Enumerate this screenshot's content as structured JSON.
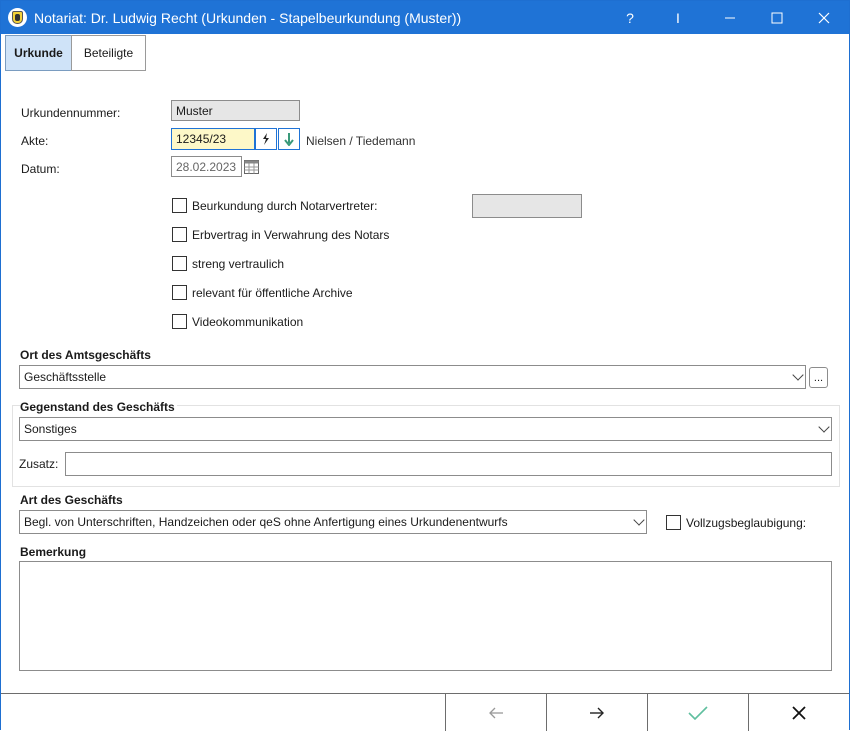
{
  "window": {
    "title": "Notariat: Dr. Ludwig Recht (Urkunden - Stapelbeurkundung (Muster))",
    "help_glyph": "?",
    "cursor_glyph": "I",
    "minimize_glyph": "—",
    "maximize_glyph": "☐",
    "close_glyph": "✕",
    "accent_color": "#1f73d6"
  },
  "tabs": [
    {
      "label": "Urkunde",
      "active": true
    },
    {
      "label": "Beteiligte",
      "active": false
    }
  ],
  "form": {
    "urkundennummer_label": "Urkundennummer:",
    "urkundennummer_value": "Muster",
    "akte_label": "Akte:",
    "akte_value": "12345/23",
    "akte_names": "Nielsen / Tiedemann",
    "datum_label": "Datum:",
    "datum_value": "28.02.2023",
    "checkboxes": [
      {
        "label": "Beurkundung durch Notarvertreter:",
        "checked": false
      },
      {
        "label": "Erbvertrag in Verwahrung des Notars",
        "checked": false
      },
      {
        "label": "streng vertraulich",
        "checked": false
      },
      {
        "label": "relevant für öffentliche Archive",
        "checked": false
      },
      {
        "label": "Videokommunikation",
        "checked": false
      }
    ],
    "notarvertreter_value": "",
    "ort_label": "Ort des Amtsgeschäfts",
    "ort_value": "Geschäftsstelle",
    "ort_button": "...",
    "gegenstand_label": "Gegenstand des Geschäfts",
    "gegenstand_value": "Sonstiges",
    "zusatz_label": "Zusatz:",
    "zusatz_value": "",
    "art_label": "Art des Geschäfts",
    "art_value": "Begl. von Unterschriften, Handzeichen oder qeS ohne Anfertigung eines Urkundenentwurfs",
    "vollzug_label": "Vollzugsbeglaubigung:",
    "vollzug_checked": false,
    "bemerkung_label": "Bemerkung",
    "bemerkung_value": ""
  },
  "bottom": {
    "back_glyph": "←",
    "forward_glyph": "→",
    "ok_glyph": "✓",
    "cancel_glyph": "✕",
    "ok_color": "#4caf8f"
  }
}
